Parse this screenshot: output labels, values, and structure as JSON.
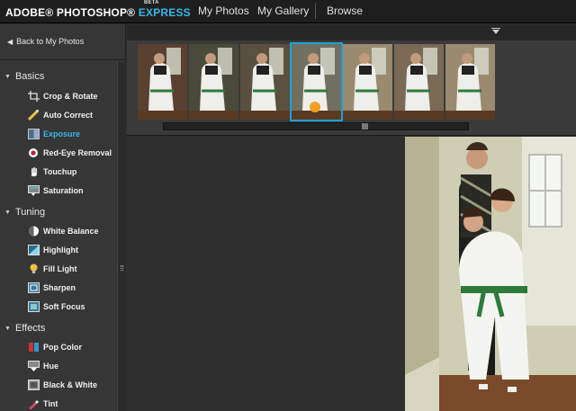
{
  "header": {
    "logo_main": "ADOBE® PHOTOSHOP®",
    "logo_express": "EXPRESS",
    "logo_beta": "BETA",
    "nav": [
      "My Photos",
      "My Gallery",
      "Browse"
    ]
  },
  "sidebar": {
    "back_label": "Back to My Photos",
    "sections": [
      {
        "title": "Basics",
        "tools": [
          {
            "label": "Crop & Rotate",
            "icon": "crop-icon"
          },
          {
            "label": "Auto Correct",
            "icon": "wand-icon"
          },
          {
            "label": "Exposure",
            "icon": "exposure-icon",
            "active": true
          },
          {
            "label": "Red-Eye Removal",
            "icon": "red-eye-icon"
          },
          {
            "label": "Touchup",
            "icon": "hand-icon"
          },
          {
            "label": "Saturation",
            "icon": "saturation-icon"
          }
        ]
      },
      {
        "title": "Tuning",
        "tools": [
          {
            "label": "White Balance",
            "icon": "white-balance-icon"
          },
          {
            "label": "Highlight",
            "icon": "highlight-icon"
          },
          {
            "label": "Fill Light",
            "icon": "bulb-icon"
          },
          {
            "label": "Sharpen",
            "icon": "sharpen-icon"
          },
          {
            "label": "Soft Focus",
            "icon": "soft-focus-icon"
          }
        ]
      },
      {
        "title": "Effects",
        "tools": [
          {
            "label": "Pop Color",
            "icon": "pop-color-icon"
          },
          {
            "label": "Hue",
            "icon": "hue-icon"
          },
          {
            "label": "Black & White",
            "icon": "black-white-icon"
          },
          {
            "label": "Tint",
            "icon": "tint-icon"
          }
        ]
      }
    ]
  },
  "filmstrip": {
    "selected_index": 3,
    "thumbnail_count": 7,
    "scroll_position": 0.66
  },
  "colors": {
    "accent": "#39b6e8",
    "selection": "#1ea0d8",
    "background": "#2f2f2f"
  }
}
